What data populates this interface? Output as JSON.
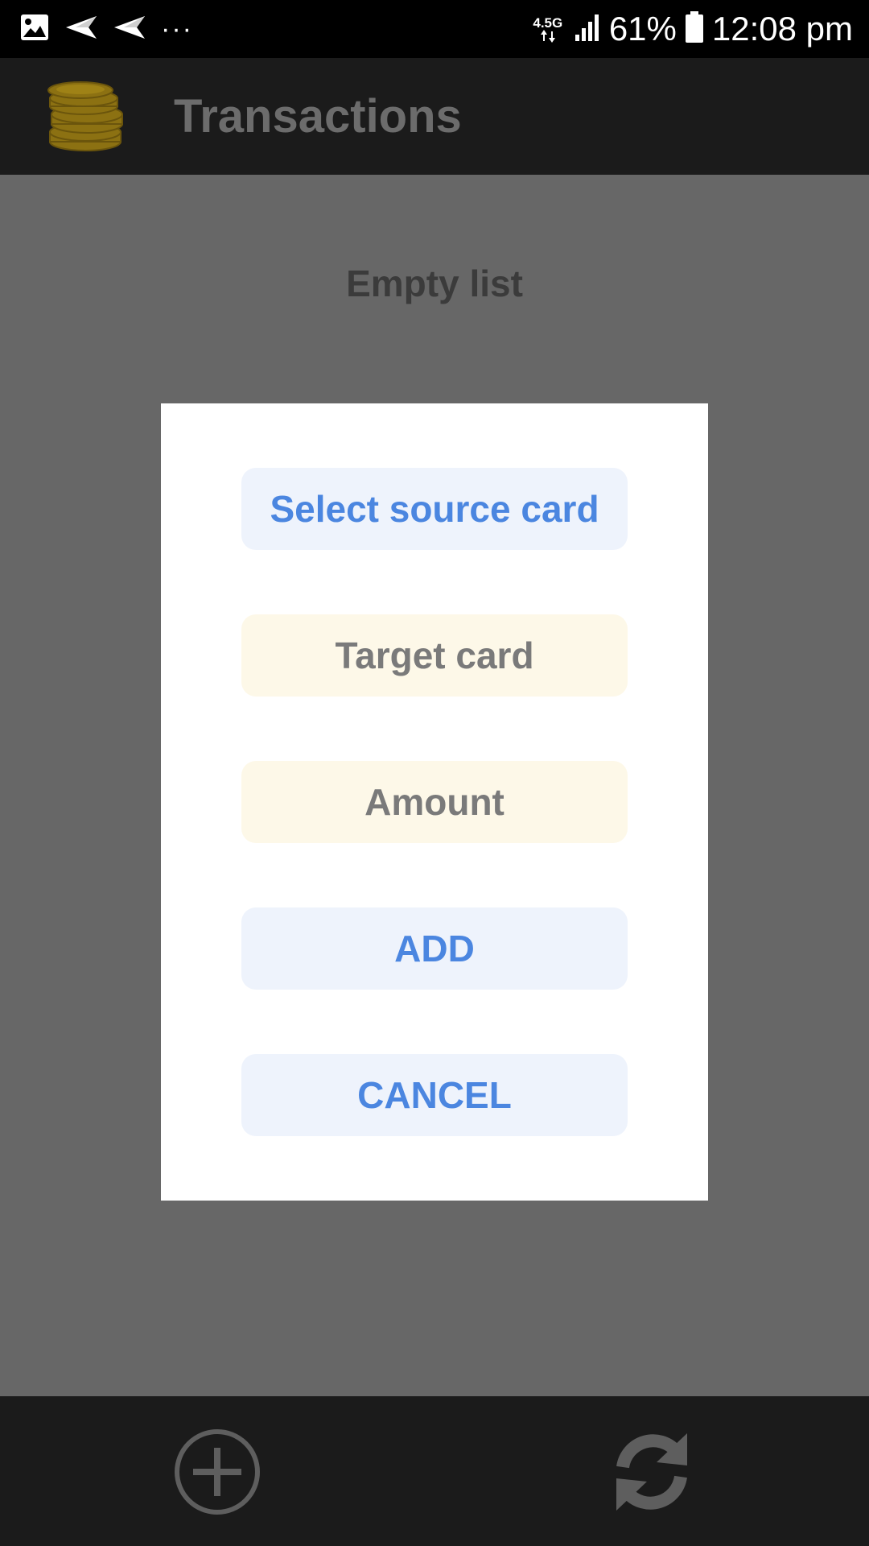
{
  "status_bar": {
    "network_type": "4.5G",
    "battery_percent": "61%",
    "time": "12:08 pm",
    "overflow": "···",
    "icons": [
      "image-icon",
      "send-icon",
      "send-icon",
      "signal-icon",
      "battery-icon"
    ]
  },
  "app_bar": {
    "title": "Transactions",
    "logo_icon": "coins-icon"
  },
  "content": {
    "empty_text": "Empty list"
  },
  "dialog": {
    "source_card_label": "Select source card",
    "target_card_placeholder": "Target card",
    "amount_placeholder": "Amount",
    "add_label": "ADD",
    "cancel_label": "CANCEL"
  },
  "bottom_bar": {
    "icons": [
      "add-circle-icon",
      "refresh-icon"
    ]
  },
  "colors": {
    "accent_blue": "#4b86e0",
    "button_blue_bg": "#eef3fc",
    "field_bg": "#fdf8e8",
    "scrim": "#676767",
    "bar_dark": "#1b1b1b",
    "coin_gold": "#8c7112"
  }
}
